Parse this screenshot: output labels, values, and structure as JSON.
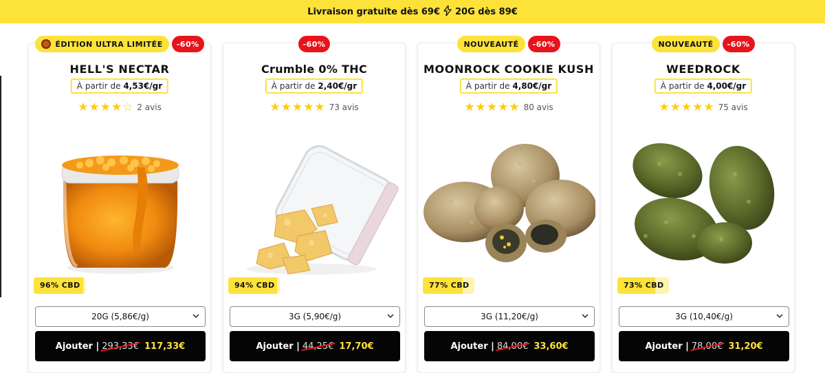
{
  "banner": {
    "text_left": "Livraison gratuite dès 69€",
    "icon": "lightning-bolt-icon",
    "text_right": "20G dès 89€"
  },
  "colors": {
    "brand_yellow": "#fde23a",
    "discount_red": "#e8141b",
    "button_black": "#050505",
    "star": "#fbcd14"
  },
  "products": [
    {
      "badges": [
        {
          "label": "ÉDITION ULTRA LIMITÉE",
          "icon": "devil-emoji-icon"
        },
        {
          "label": "-60%"
        }
      ],
      "name": "HELL'S NECTAR",
      "price_prefix": "À partir de",
      "price_value": "4,53€/gr",
      "rating": 4,
      "reviews": "2 avis",
      "cbd_label": "96% CBD",
      "cbd_percent": 96,
      "select_value": "20G (5,86€/g)",
      "button_label": "Ajouter |",
      "old_price": "293,33€",
      "new_price": "117,33€",
      "image": "honey-jar"
    },
    {
      "badges": [
        {
          "label": "-60%"
        }
      ],
      "name": "Crumble 0% THC",
      "price_prefix": "À partir de",
      "price_value": "2,40€/gr",
      "rating": 5,
      "reviews": "73 avis",
      "cbd_label": "94% CBD",
      "cbd_percent": 94,
      "select_value": "3G (5,90€/g)",
      "button_label": "Ajouter |",
      "old_price": "44,25€",
      "new_price": "17,70€",
      "image": "crumble-jar"
    },
    {
      "badges": [
        {
          "label": "NOUVEAUTÉ"
        },
        {
          "label": "-60%"
        }
      ],
      "name": "MOONROCK COOKIE KUSH",
      "price_prefix": "À partir de",
      "price_value": "4,80€/gr",
      "rating": 5,
      "reviews": "80 avis",
      "cbd_label": "77% CBD",
      "cbd_percent": 77,
      "select_value": "3G (11,20€/g)",
      "button_label": "Ajouter |",
      "old_price": "84,00€",
      "new_price": "33,60€",
      "image": "moonrock-buds"
    },
    {
      "badges": [
        {
          "label": "NOUVEAUTÉ"
        },
        {
          "label": "-60%"
        }
      ],
      "name": "WEEDROCK",
      "price_prefix": "À partir de",
      "price_value": "4,00€/gr",
      "rating": 5,
      "reviews": "75 avis",
      "cbd_label": "73% CBD",
      "cbd_percent": 73,
      "select_value": "3G (10,40€/g)",
      "button_label": "Ajouter |",
      "old_price": "78,00€",
      "new_price": "31,20€",
      "image": "weedrock-buds"
    }
  ]
}
